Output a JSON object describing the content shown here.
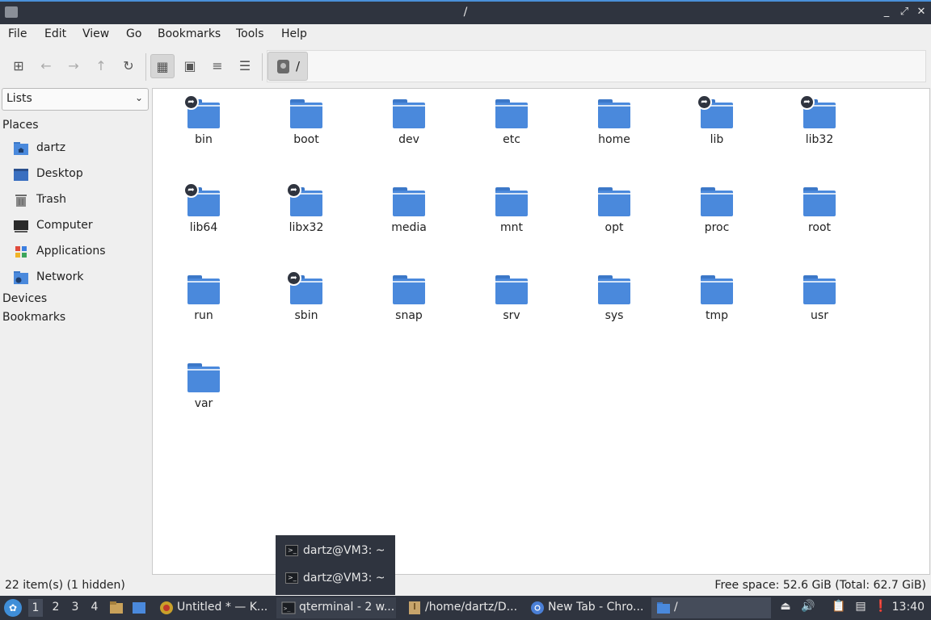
{
  "window": {
    "title": "/"
  },
  "menu": [
    "File",
    "Edit",
    "View",
    "Go",
    "Bookmarks",
    "Tools",
    "Help"
  ],
  "toolbar": {
    "icons": [
      "new-tab-icon",
      "back-icon",
      "forward-icon",
      "up-icon",
      "reload-icon",
      "icon-view-icon",
      "thumbnail-view-icon",
      "compact-view-icon",
      "detailed-list-icon"
    ],
    "path": "/"
  },
  "side": {
    "combo_value": "Lists",
    "places_label": "Places",
    "places": [
      {
        "label": "dartz",
        "icon": "home-folder-icon"
      },
      {
        "label": "Desktop",
        "icon": "desktop-icon"
      },
      {
        "label": "Trash",
        "icon": "trash-icon"
      },
      {
        "label": "Computer",
        "icon": "computer-icon"
      },
      {
        "label": "Applications",
        "icon": "applications-icon"
      },
      {
        "label": "Network",
        "icon": "network-icon"
      }
    ],
    "devices_label": "Devices",
    "bookmarks_label": "Bookmarks"
  },
  "files": [
    {
      "name": "bin",
      "link": true
    },
    {
      "name": "boot",
      "link": false
    },
    {
      "name": "dev",
      "link": false
    },
    {
      "name": "etc",
      "link": false
    },
    {
      "name": "home",
      "link": false
    },
    {
      "name": "lib",
      "link": true
    },
    {
      "name": "lib32",
      "link": true
    },
    {
      "name": "lib64",
      "link": true
    },
    {
      "name": "libx32",
      "link": true
    },
    {
      "name": "media",
      "link": false
    },
    {
      "name": "mnt",
      "link": false
    },
    {
      "name": "opt",
      "link": false
    },
    {
      "name": "proc",
      "link": false
    },
    {
      "name": "root",
      "link": false
    },
    {
      "name": "run",
      "link": false
    },
    {
      "name": "sbin",
      "link": true
    },
    {
      "name": "snap",
      "link": false
    },
    {
      "name": "srv",
      "link": false
    },
    {
      "name": "sys",
      "link": false
    },
    {
      "name": "tmp",
      "link": false
    },
    {
      "name": "usr",
      "link": false
    },
    {
      "name": "var",
      "link": false
    }
  ],
  "status": {
    "left": "22 item(s) (1 hidden)",
    "right": "Free space: 52.6 GiB (Total: 62.7 GiB)"
  },
  "popup": {
    "items": [
      "dartz@VM3: ~",
      "dartz@VM3: ~"
    ]
  },
  "taskbar": {
    "workspaces": [
      "1",
      "2",
      "3",
      "4"
    ],
    "tasks": [
      {
        "label": "Untitled * — K...",
        "icon": "kate-icon"
      },
      {
        "label": "qterminal - 2 w...",
        "icon": "terminal-icon"
      },
      {
        "label": "/home/dartz/D...",
        "icon": "archive-icon"
      },
      {
        "label": "New Tab - Chro...",
        "icon": "chromium-icon"
      },
      {
        "label": "/",
        "icon": "folder-icon"
      }
    ],
    "clock": "13:40"
  },
  "colors": {
    "folder": "#4a89dc",
    "panel": "#2f343f",
    "accent": "#4a90d9"
  }
}
